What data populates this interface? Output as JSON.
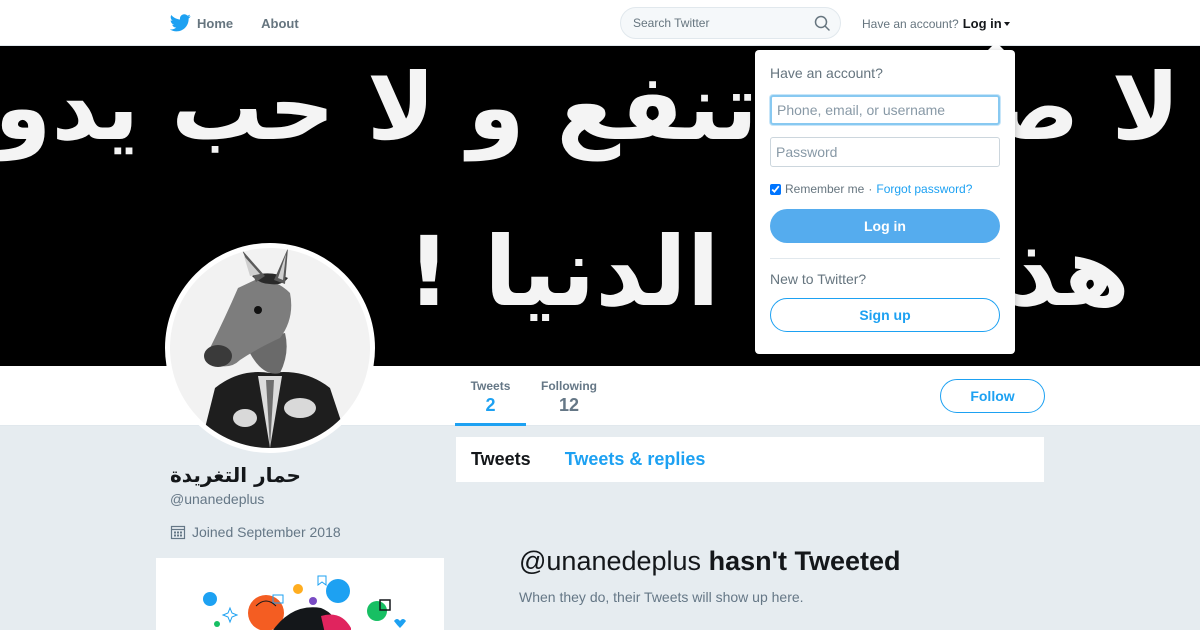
{
  "nav": {
    "logo_icon": "twitter-bird-icon",
    "home_label": "Home",
    "about_label": "About",
    "search_placeholder": "Search Twitter",
    "account_prompt": "Have an account?",
    "login_label": "Log in"
  },
  "banner": {
    "line1": "لا صداقة تنفع و لا حب يدوم",
    "line2": "هذا حال الدنيا !"
  },
  "profile": {
    "name": "حمار التغريدة",
    "handle": "@unanedeplus",
    "joined": "Joined September 2018",
    "stats": [
      {
        "label": "Tweets",
        "value": "2"
      },
      {
        "label": "Following",
        "value": "12"
      }
    ],
    "follow_label": "Follow"
  },
  "timeline": {
    "tabs": [
      {
        "label": "Tweets"
      },
      {
        "label": "Tweets & replies"
      }
    ],
    "empty_handle": "@unanedeplus",
    "empty_rest": "hasn't Tweeted",
    "empty_sub": "When they do, their Tweets will show up here."
  },
  "login_dropdown": {
    "title": "Have an account?",
    "username_placeholder": "Phone, email, or username",
    "password_placeholder": "Password",
    "remember_label": "Remember me",
    "separator": "·",
    "forgot_label": "Forgot password?",
    "login_button": "Log in",
    "new_prompt": "New to Twitter?",
    "signup_button": "Sign up"
  },
  "colors": {
    "accent": "#1da1f2",
    "background": "#e6ecf0",
    "login_button": "#55acee"
  }
}
